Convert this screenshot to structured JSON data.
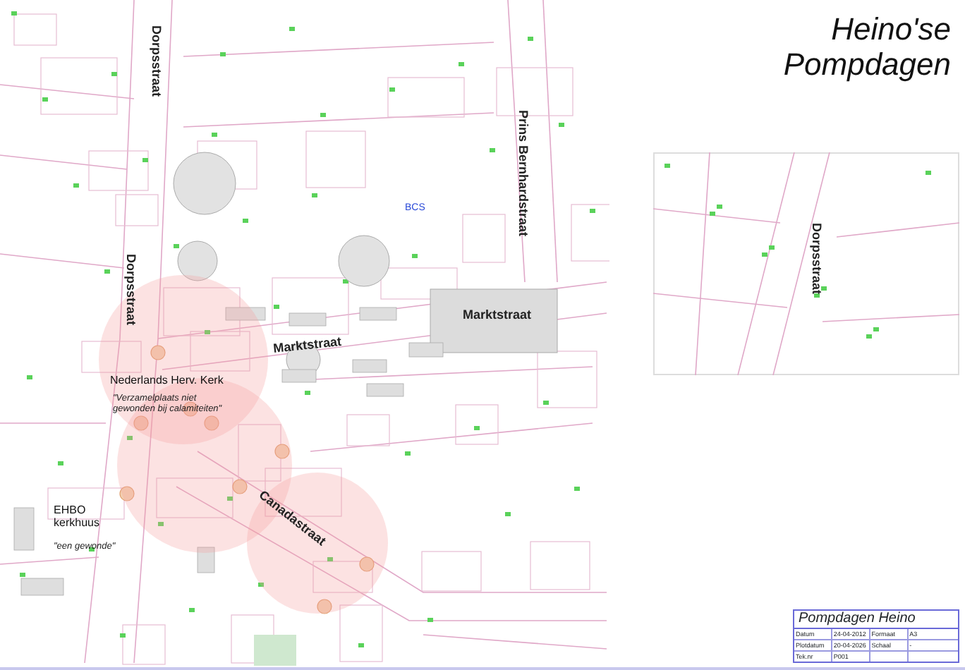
{
  "sheet_title": [
    "Heino'se",
    "Pompdagen"
  ],
  "map_labels": [
    {
      "kind": "street",
      "lines": [
        "Dorpsstraat"
      ]
    },
    {
      "kind": "street",
      "lines": [
        "Dorpsstraat"
      ]
    },
    {
      "kind": "street",
      "lines": [
        "Prins Bernhardstraat"
      ]
    },
    {
      "kind": "marker",
      "lines": [
        "BCS"
      ]
    },
    {
      "kind": "street",
      "lines": [
        "Marktstraat"
      ]
    },
    {
      "kind": "street",
      "lines": [
        "Marktstraat"
      ]
    },
    {
      "kind": "place",
      "lines": [
        "Nederlands Herv. Kerk"
      ]
    },
    {
      "kind": "note",
      "lines": [
        "\"Verzamelplaats niet",
        "gewonden bij calamiteiten\""
      ]
    },
    {
      "kind": "place",
      "lines": [
        "EHBO",
        "kerkhuus"
      ]
    },
    {
      "kind": "note",
      "lines": [
        "\"een gewonde\""
      ]
    },
    {
      "kind": "street",
      "lines": [
        "Canadastraat"
      ]
    }
  ],
  "inset_labels": [
    {
      "kind": "street",
      "lines": [
        "Dorpsstraat"
      ]
    }
  ],
  "title_block": {
    "title": "Pompdagen Heino",
    "rows": [
      [
        "Datum",
        "24-04-2012",
        "Formaat",
        "A3"
      ],
      [
        "Plotdatum",
        "20-04-2026",
        "Schaal",
        "-"
      ],
      [
        "Tek.nr",
        "P001",
        "",
        ""
      ]
    ]
  }
}
